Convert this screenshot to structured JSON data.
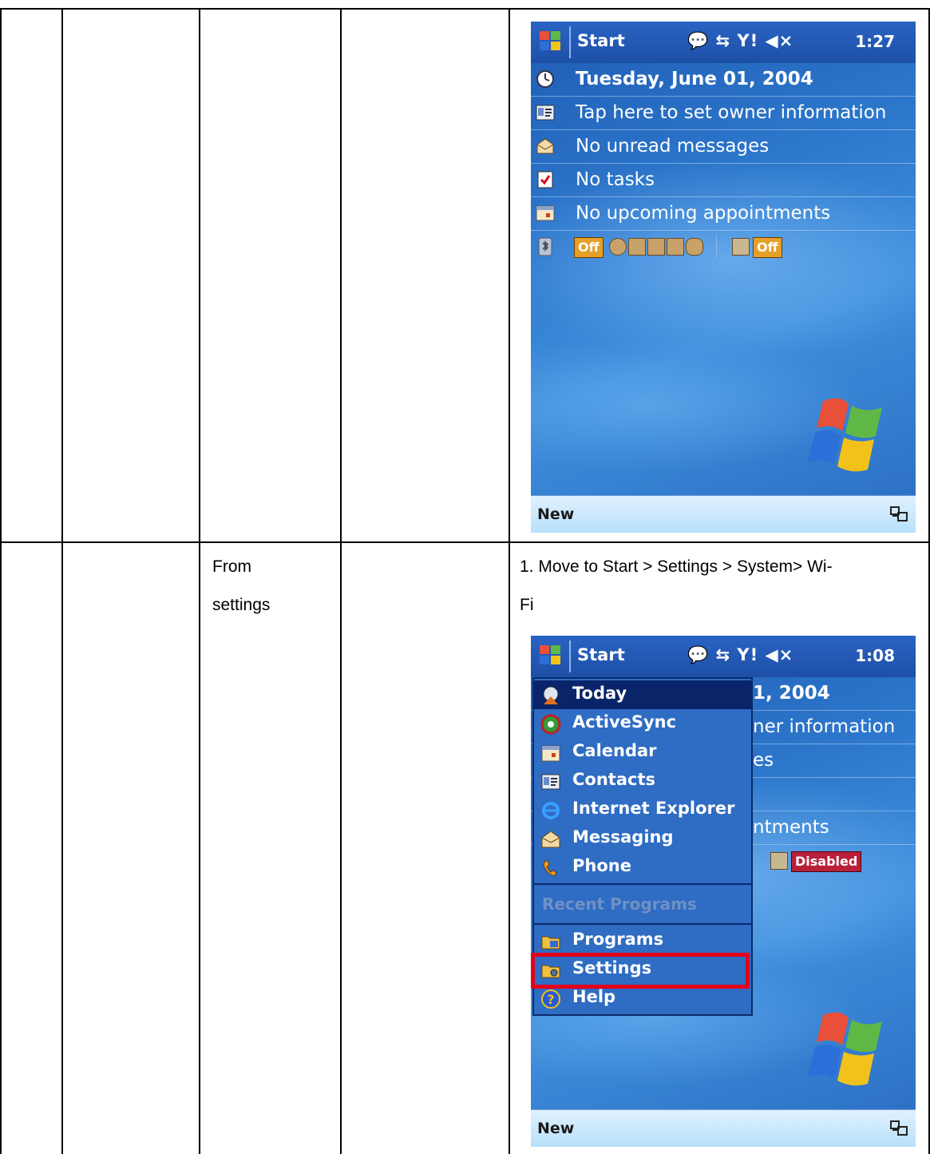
{
  "row2": {
    "col3_line1": "From",
    "col3_line2": "settings",
    "instruction_line1": "1. Move to Start > Settings > System> Wi-",
    "instruction_line2": "Fi"
  },
  "screen1": {
    "start_label": "Start",
    "tray_icons": "💬 ⇆ Y! ◀×",
    "time": "1:27",
    "today_items": [
      {
        "label": "Tuesday, June 01, 2004",
        "icon": "clock-icon"
      },
      {
        "label": "Tap here to set owner information",
        "icon": "contact-card-icon"
      },
      {
        "label": "No unread messages",
        "icon": "envelope-icon"
      },
      {
        "label": "No tasks",
        "icon": "task-check-icon"
      },
      {
        "label": "No upcoming appointments",
        "icon": "calendar-icon"
      }
    ],
    "bt_badge_1": "Off",
    "bt_badge_2": "Off",
    "softkey_left": "New"
  },
  "screen2": {
    "start_label": "Start",
    "tray_icons": "💬 ⇆ Y! ◀×",
    "time": "1:08",
    "partial_date": "1, 2004",
    "partial_owner": "ner information",
    "partial_msgs": "es",
    "partial_appt": "ntments",
    "disabled_badge": "Disabled",
    "softkey_left": "New",
    "menu_items": [
      {
        "label": "Today",
        "icon": "today-icon"
      },
      {
        "label": "ActiveSync",
        "icon": "activesync-icon"
      },
      {
        "label": "Calendar",
        "icon": "calendar-icon"
      },
      {
        "label": "Contacts",
        "icon": "contacts-icon"
      },
      {
        "label": "Internet Explorer",
        "icon": "internet-explorer-icon"
      },
      {
        "label": "Messaging",
        "icon": "messaging-icon"
      },
      {
        "label": "Phone",
        "icon": "phone-icon"
      }
    ],
    "recent_programs": "Recent Programs",
    "bottom_items": [
      {
        "label": "Programs",
        "icon": "programs-folder-icon"
      },
      {
        "label": "Settings",
        "icon": "settings-folder-icon"
      },
      {
        "label": "Help",
        "icon": "help-icon"
      }
    ]
  },
  "colors": {
    "highlight": "#e3001b",
    "title_bar": "#1e4fa6",
    "selected_item": "#0a246a"
  }
}
